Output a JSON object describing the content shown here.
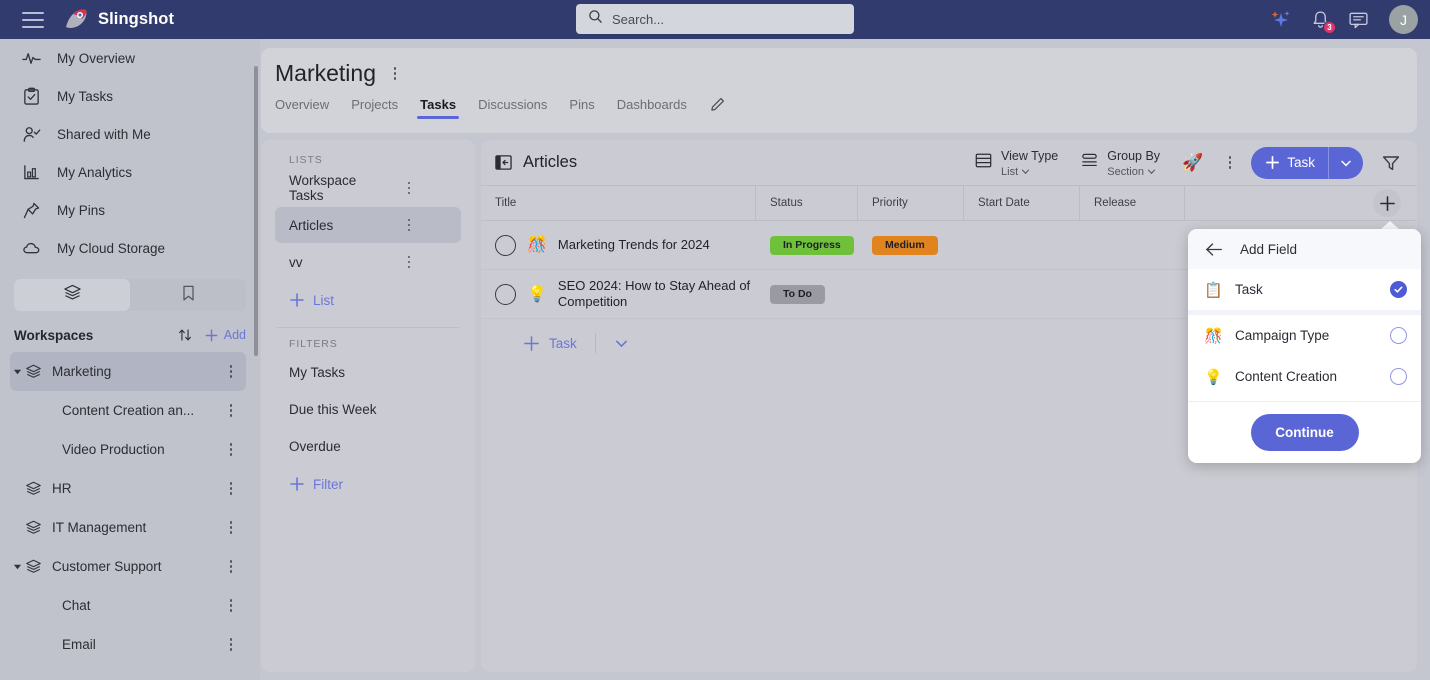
{
  "topbar": {
    "menu_icon": "hamburger-icon",
    "brand": "Slingshot",
    "search": {
      "placeholder": "Search...",
      "icon": "search-icon"
    },
    "ai_icon": "sparkle-icon",
    "notifications": {
      "icon": "bell-icon",
      "count": "3"
    },
    "messages_icon": "chat-icon",
    "avatar_initial": "J"
  },
  "sidebar": {
    "nav": [
      {
        "label": "My Overview",
        "icon": "activity-icon"
      },
      {
        "label": "My Tasks",
        "icon": "clipboard-check-icon"
      },
      {
        "label": "Shared with Me",
        "icon": "user-check-icon"
      },
      {
        "label": "My Analytics",
        "icon": "bar-chart-icon"
      },
      {
        "label": "My Pins",
        "icon": "pin-icon"
      },
      {
        "label": "My Cloud Storage",
        "icon": "cloud-icon"
      }
    ],
    "tabs": [
      {
        "icon": "layers-icon",
        "active": true
      },
      {
        "icon": "bookmark-icon",
        "active": false
      }
    ],
    "workspaces_label": "Workspaces",
    "sort_icon": "sort-arrows-icon",
    "add_label": "Add",
    "workspaces": [
      {
        "label": "Marketing",
        "level": 0,
        "expanded": true,
        "active": true
      },
      {
        "label": "Content Creation an...",
        "level": 1,
        "expanded": false,
        "active": false
      },
      {
        "label": "Video Production",
        "level": 1,
        "expanded": false,
        "active": false
      },
      {
        "label": "HR",
        "level": 0,
        "expanded": false,
        "active": false
      },
      {
        "label": "IT Management",
        "level": 0,
        "expanded": false,
        "active": false
      },
      {
        "label": "Customer Support",
        "level": 0,
        "expanded": true,
        "active": false
      },
      {
        "label": "Chat",
        "level": 1,
        "expanded": false,
        "active": false
      },
      {
        "label": "Email",
        "level": 1,
        "expanded": false,
        "active": false
      }
    ]
  },
  "page": {
    "title": "Marketing",
    "kebab_icon": "kebab-menu-icon",
    "tabs": [
      {
        "label": "Overview",
        "active": false
      },
      {
        "label": "Projects",
        "active": false
      },
      {
        "label": "Tasks",
        "active": true
      },
      {
        "label": "Discussions",
        "active": false
      },
      {
        "label": "Pins",
        "active": false
      },
      {
        "label": "Dashboards",
        "active": false
      }
    ],
    "edit_icon": "pencil-icon"
  },
  "lists_panel": {
    "lists_header": "LISTS",
    "lists": [
      {
        "label": "Workspace Tasks",
        "active": false
      },
      {
        "label": "Articles",
        "active": true
      },
      {
        "label": "vv",
        "active": false
      }
    ],
    "add_list_label": "List",
    "filters_header": "FILTERS",
    "filters": [
      {
        "label": "My Tasks"
      },
      {
        "label": "Due this Week"
      },
      {
        "label": "Overdue"
      }
    ],
    "add_filter_label": "Filter"
  },
  "table": {
    "title": "Articles",
    "collapse_icon": "collapse-panel-icon",
    "view_type": {
      "label": "View Type",
      "value": "List",
      "icon": "list-view-icon"
    },
    "group_by": {
      "label": "Group By",
      "value": "Section",
      "icon": "group-by-icon"
    },
    "rocket_icon": "rocket-icon",
    "kebab_icon": "kebab-menu-icon",
    "add_task_button": "Task",
    "filter_icon": "funnel-icon",
    "add_column_icon": "plus-icon",
    "columns": [
      "Title",
      "Status",
      "Priority",
      "Start Date",
      "Release"
    ],
    "rows": [
      {
        "title": "Marketing Trends for 2024",
        "emoji": "🎊",
        "status": {
          "label": "In Progress",
          "color": "#6fc03b"
        },
        "priority": {
          "label": "Medium",
          "color": "#e0841f"
        },
        "start_date": "",
        "release": "",
        "trailing": "—"
      },
      {
        "title": "SEO 2024: How to Stay Ahead of Competition",
        "emoji": "💡",
        "status": {
          "label": "To Do",
          "color": "#9a9aa2"
        },
        "priority": {
          "label": "",
          "color": ""
        },
        "start_date": "",
        "release": "",
        "trailing": ""
      }
    ],
    "add_row_label": "Task"
  },
  "add_field_popup": {
    "back_icon": "arrow-left-icon",
    "title": "Add Field",
    "options": [
      {
        "label": "Task",
        "emoji": "📋",
        "selected": true
      },
      {
        "label": "Campaign Type",
        "emoji": "🎊",
        "selected": false
      },
      {
        "label": "Content Creation",
        "emoji": "💡",
        "selected": false
      }
    ],
    "continue_label": "Continue"
  },
  "colors": {
    "topbar": "#323b6e",
    "accent": "#5b66d6",
    "page_bg": "#c4c6d0",
    "panel": "#cbccd3"
  }
}
